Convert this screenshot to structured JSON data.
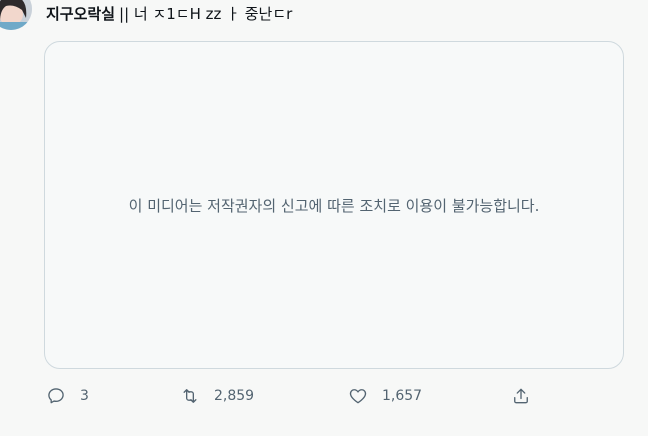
{
  "tweet": {
    "username": "지구오락실",
    "handle": "|| 너 ㅈ1ㄷH zz ㅏ 중난ㄷr"
  },
  "media": {
    "message": "이 미디어는 저작권자의 신고에 따른 조치로 이용이 불가능합니다."
  },
  "actions": {
    "reply": {
      "icon": "reply-icon",
      "count": "3"
    },
    "retweet": {
      "icon": "retweet-icon",
      "count": "2,859"
    },
    "like": {
      "icon": "heart-icon",
      "count": "1,657"
    },
    "share": {
      "icon": "share-icon"
    }
  },
  "colors": {
    "background": "#f7f8f7",
    "muted_text": "#536471",
    "card_border": "#cfd9de",
    "card_background": "#f7f9f9"
  }
}
